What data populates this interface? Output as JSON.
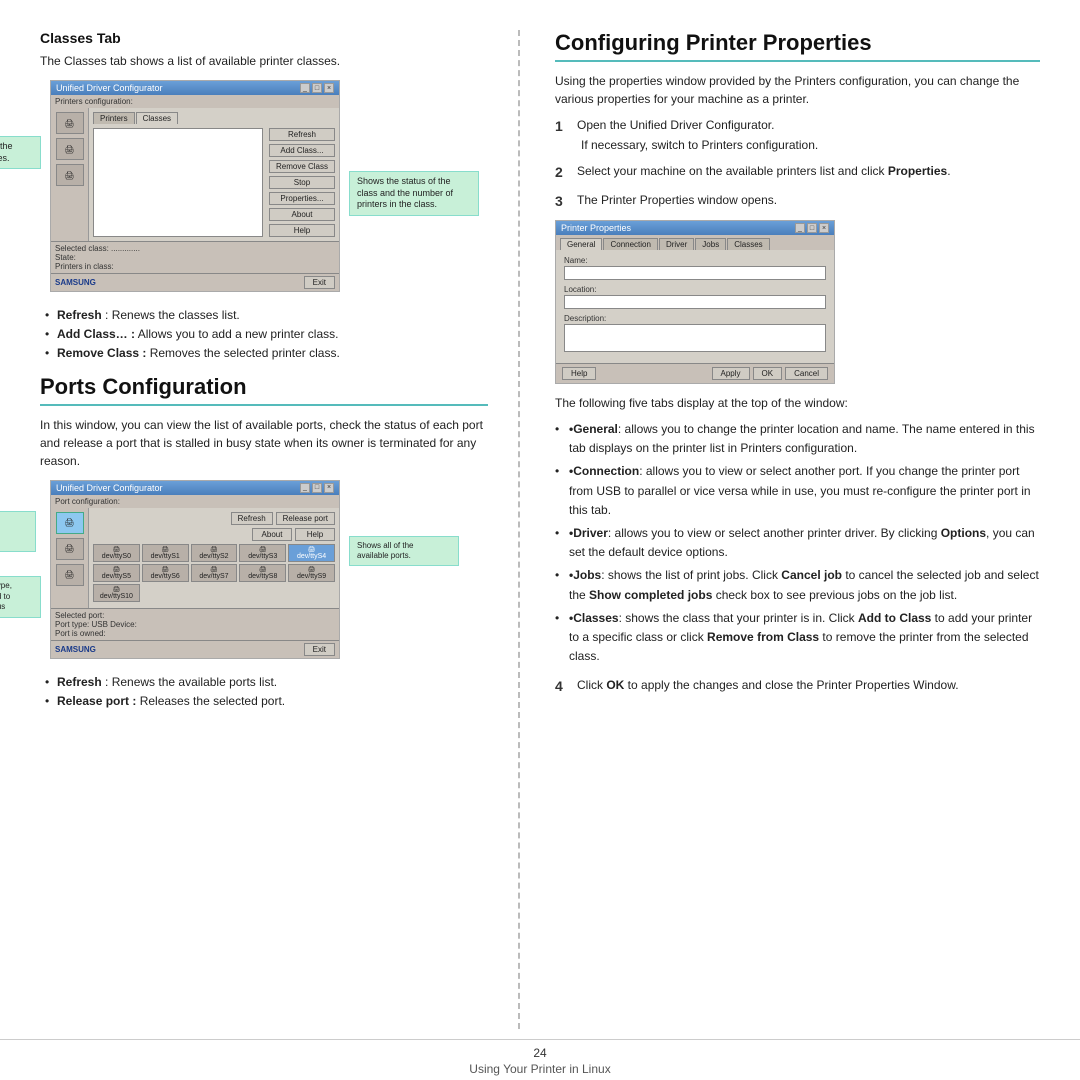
{
  "left": {
    "classes_tab": {
      "title": "Classes Tab",
      "description": "The Classes tab shows a list of available printer classes.",
      "screenshot_title": "Unified Driver Configurator",
      "config_label": "Printers configuration:",
      "tabs": [
        "Printers",
        "Classes"
      ],
      "buttons": [
        "Refresh",
        "Add Class...",
        "Remove Class",
        "Stop",
        "Properties...",
        "About",
        "Help"
      ],
      "status_items": [
        "Selected class:",
        "State:",
        "Printers in class:"
      ],
      "callout_left": "Shows all of the printer classes.",
      "callout_right": "Shows the status of the\nclass and the number of\nprinters in the class.",
      "exit_btn": "Exit"
    },
    "bullet_items": [
      {
        "label": "Refresh",
        "text": " : Renews the classes list."
      },
      {
        "label": "Add Class…",
        "prefix": " : ",
        "text": "Allows you to add a new printer class."
      },
      {
        "label": "Remove Class",
        "prefix": " : ",
        "text": "Removes the selected printer class."
      }
    ],
    "ports_config": {
      "title": "Ports Configuration",
      "description": "In this window, you can view the list of available ports, check the status of each port and release a port that is stalled in busy state when its owner is terminated for any reason.",
      "screenshot_title": "Unified Driver Configurator",
      "config_label": "Port configuration:",
      "tabs": [
        "Refresh",
        "Release port",
        "About",
        "Help"
      ],
      "callout_switches": "Switches to\nports\nconfiguration.",
      "callout_shows": "Shows all of the\navailable ports.",
      "callout_port_type": "Shows the port type,\ndevice connected to\nthe port and status",
      "port_rows": [
        [
          "dev/ttyS0",
          "dev/ttyS1",
          "dev/ttyS2",
          "dev/ttyS3",
          "dev/ttyS4"
        ],
        [
          "dev/ttyS5",
          "dev/ttyS6",
          "dev/ttyS7",
          "dev/ttyS8",
          "dev/ttyS9"
        ],
        [
          "dev/ttyS10",
          ""
        ]
      ],
      "status_items": [
        "Selected port:",
        "Port type: USB  Device:",
        "Port is owned:"
      ],
      "exit_btn": "Exit"
    },
    "ports_bullets": [
      {
        "label": "Refresh",
        "text": " : Renews the available ports list."
      },
      {
        "label": "Release port",
        "prefix": " : ",
        "text": "Releases the selected port."
      }
    ]
  },
  "right": {
    "title": "Configuring Printer Properties",
    "intro": "Using the properties window provided by the Printers configuration, you can change the various properties for your machine as a printer.",
    "steps": [
      {
        "num": "1",
        "text": "Open the Unified Driver Configurator.",
        "sub": "If necessary, switch to Printers configuration."
      },
      {
        "num": "2",
        "text": "Select your machine on the available printers list and click ",
        "bold": "Properties",
        "text2": "."
      },
      {
        "num": "3",
        "text": "The Printer Properties window opens."
      }
    ],
    "printer_props": {
      "title": "Printer Properties",
      "tabs": [
        "General",
        "Connection",
        "Driver",
        "Jobs",
        "Classes"
      ],
      "fields": [
        "Name:",
        "Location:",
        "Description:"
      ],
      "footer_buttons": [
        "Help",
        "Apply",
        "OK",
        "Cancel"
      ]
    },
    "following_text": "The following five tabs display at the top of the window:",
    "tab_descriptions": [
      {
        "label": "General",
        "text": ": allows you to change the printer location and name. The name entered in this tab displays on the printer list in Printers configuration."
      },
      {
        "label": "Connection",
        "text": ": allows you to view or select another port. If you change the printer port from USB to parallel or vice versa while in use, you must re-configure the printer port in this tab."
      },
      {
        "label": "Driver",
        "text": ": allows you to view or select another printer driver. By clicking ",
        "bold": "Options",
        "text2": ", you can set the default device options."
      },
      {
        "label": "Jobs",
        "text": ": shows the list of print jobs. Click ",
        "bold": "Cancel job",
        "text2": " to cancel the selected job and select the ",
        "bold2": "Show completed jobs",
        "text3": " check box to see previous jobs on the job list."
      },
      {
        "label": "Classes",
        "text": ": shows the class that your printer is in. Click ",
        "bold": "Add to Class",
        "text2": " to add your printer to a specific class or click ",
        "bold2": "Remove from Class",
        "text3": " to remove the printer from the selected class."
      }
    ],
    "step4": {
      "num": "4",
      "text": "Click ",
      "bold": "OK",
      "text2": " to apply the changes and close the Printer Properties Window."
    }
  },
  "footer": {
    "page_num": "24",
    "caption": "Using Your Printer in Linux"
  }
}
